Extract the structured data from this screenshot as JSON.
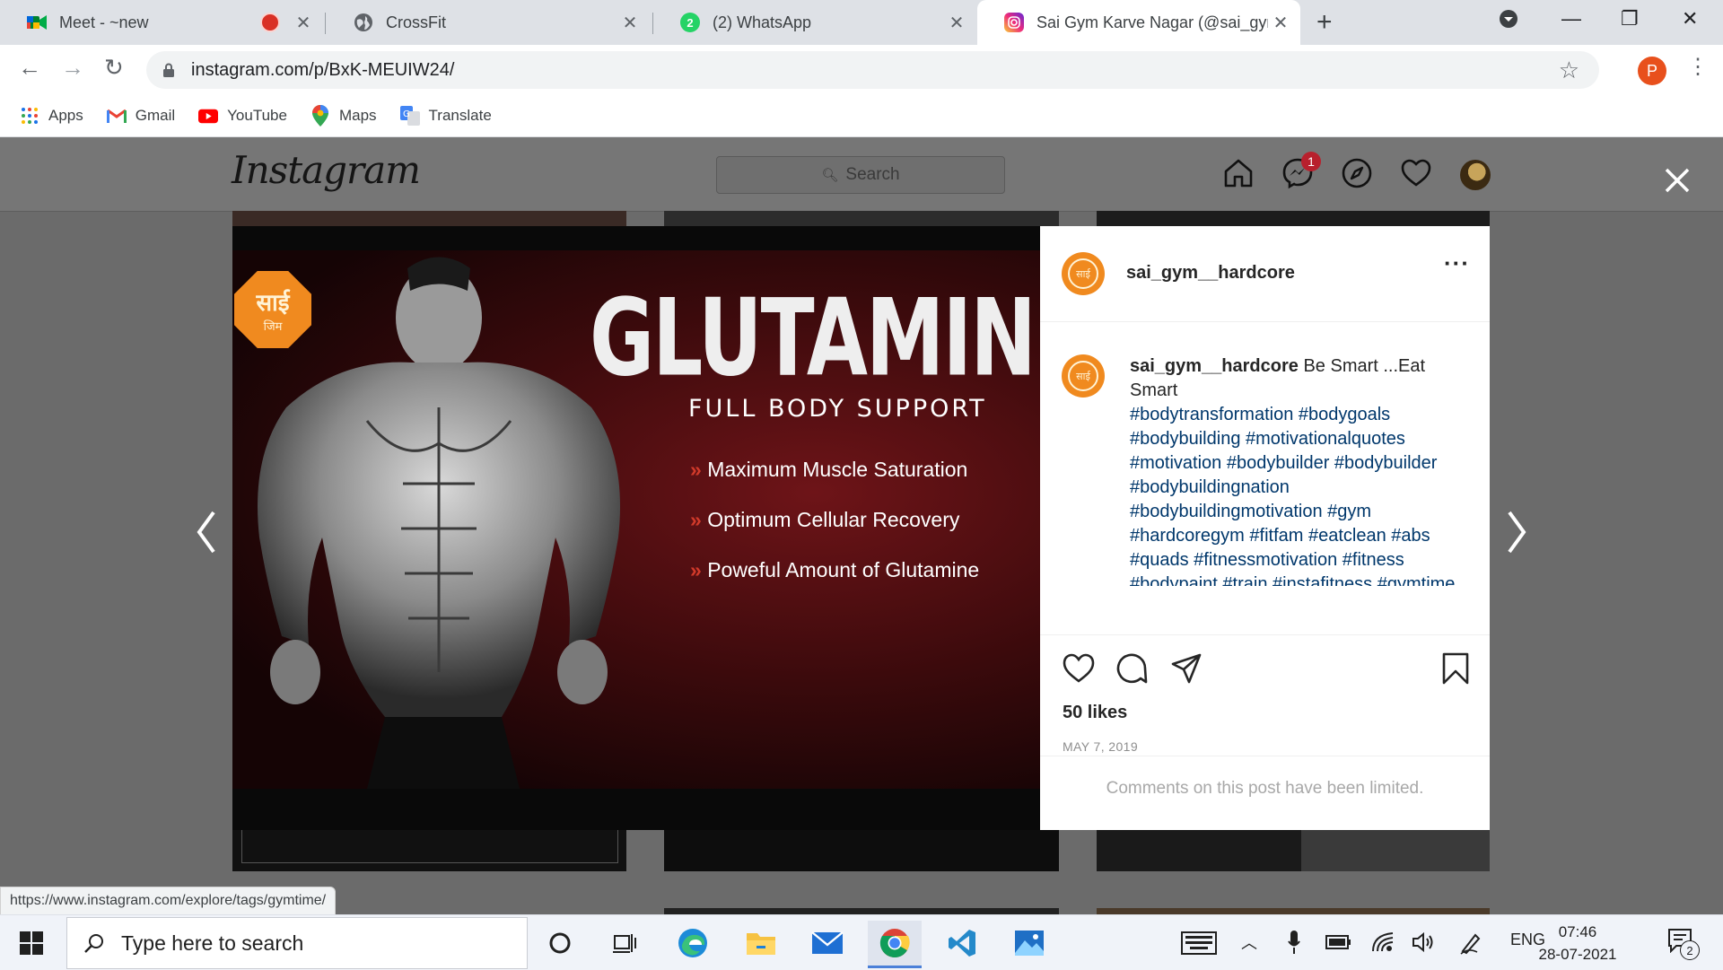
{
  "browser": {
    "tabs": [
      {
        "title": "Meet - ~new",
        "icon": "google-meet-icon"
      },
      {
        "title": "CrossFit",
        "icon": "globe-icon"
      },
      {
        "title": "(2) WhatsApp",
        "icon": "whatsapp-icon",
        "badge": "2"
      },
      {
        "title": "Sai Gym Karve Nagar (@sai_gym_",
        "icon": "instagram-icon"
      }
    ],
    "url": "instagram.com/p/BxK-MEUIW24/",
    "profile_initial": "P",
    "bookmarks": [
      "Apps",
      "Gmail",
      "YouTube",
      "Maps",
      "Translate"
    ]
  },
  "instagram": {
    "logo": "Instagram",
    "search_placeholder": "Search",
    "notification_count": "1",
    "post": {
      "username": "sai_gym__hardcore",
      "avatar_text": "साई",
      "caption_text": "Be Smart ...Eat Smart",
      "hashtags": "#bodytransformation #bodygoals #bodybuilding #motivationalquotes #motivation #bodybuilder #bodybuilder #bodybuildingnation #bodybuildingmotivation #gym #hardcoregym #fitfam #eatclean #abs #quads #fitnessmotivation #fitness #bodypaint #train #instafitness #gymtime #gymrat #nopainnogain #determination #glutamine",
      "likes": "50 likes",
      "date": "MAY 7, 2019",
      "comments_notice": "Comments on this post have been limited.",
      "image": {
        "logo_text": "साई",
        "logo_sub": "जिम",
        "headline": "GLUTAMINE",
        "subhead": "FULL BODY SUPPORT",
        "bullets": [
          "Maximum Muscle Saturation",
          "Optimum Cellular Recovery",
          "Poweful Amount of Glutamine"
        ]
      }
    }
  },
  "status_bar_url": "https://www.instagram.com/explore/tags/gymtime/",
  "taskbar": {
    "search_placeholder": "Type here to search",
    "language": "ENG",
    "time": "07:46",
    "date": "28-07-2021",
    "notification_count": "2"
  }
}
